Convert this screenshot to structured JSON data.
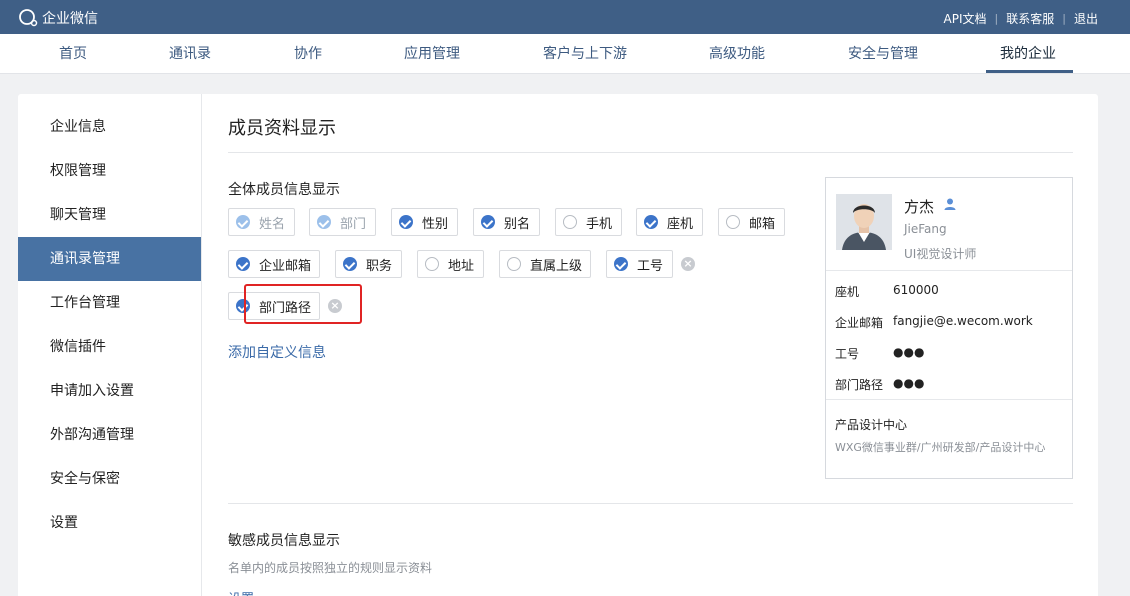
{
  "topbar": {
    "brand": "企业微信",
    "links": [
      {
        "label": "API文档"
      },
      {
        "label": "联系客服"
      },
      {
        "label": "退出"
      }
    ]
  },
  "nav": {
    "items": [
      {
        "label": "首页"
      },
      {
        "label": "通讯录"
      },
      {
        "label": "协作"
      },
      {
        "label": "应用管理"
      },
      {
        "label": "客户与上下游"
      },
      {
        "label": "高级功能"
      },
      {
        "label": "安全与管理"
      },
      {
        "label": "我的企业"
      }
    ],
    "active": "我的企业"
  },
  "sidebar": {
    "items": [
      {
        "label": "企业信息"
      },
      {
        "label": "权限管理"
      },
      {
        "label": "聊天管理"
      },
      {
        "label": "通讯录管理"
      },
      {
        "label": "工作台管理"
      },
      {
        "label": "微信插件"
      },
      {
        "label": "申请加入设置"
      },
      {
        "label": "外部沟通管理"
      },
      {
        "label": "安全与保密"
      },
      {
        "label": "设置"
      }
    ],
    "active": "通讯录管理"
  },
  "main": {
    "title": "成员资料显示",
    "all_section_label": "全体成员信息显示",
    "fields": [
      {
        "label": "姓名",
        "checked": true,
        "disabled": true
      },
      {
        "label": "部门",
        "checked": true,
        "disabled": true
      },
      {
        "label": "性别",
        "checked": true
      },
      {
        "label": "别名",
        "checked": true
      },
      {
        "label": "手机",
        "checked": false
      },
      {
        "label": "座机",
        "checked": true
      },
      {
        "label": "邮箱",
        "checked": false
      },
      {
        "label": "企业邮箱",
        "checked": true
      },
      {
        "label": "职务",
        "checked": true
      },
      {
        "label": "地址",
        "checked": false
      },
      {
        "label": "直属上级",
        "checked": false
      },
      {
        "label": "工号",
        "checked": true,
        "removable": true
      },
      {
        "label": "部门路径",
        "checked": true,
        "removable": true,
        "highlighted": true
      }
    ],
    "remove_glyph": "×",
    "add_custom_label": "添加自定义信息",
    "sensitive_section_label": "敏感成员信息显示",
    "sensitive_desc": "名单内的成员按照独立的规则显示资料",
    "sensitive_link": "设置"
  },
  "preview": {
    "name": "方杰",
    "alias": "JieFang",
    "job_title": "UI视觉设计师",
    "rows": [
      {
        "key": "座机",
        "value": "610000"
      },
      {
        "key": "企业邮箱",
        "value": "fangjie@e.wecom.work"
      },
      {
        "key": "工号",
        "value": "●●●"
      },
      {
        "key": "部门路径",
        "value": "●●●"
      }
    ],
    "department": "产品设计中心",
    "department_path": "WXG微信事业群/广州研发部/产品设计中心"
  },
  "colors": {
    "topbar": "#3f5f86",
    "accent": "#3c74c9",
    "sidebar_active": "#4872a3",
    "highlight": "#e02424",
    "link": "#3a6aa8"
  },
  "icons": {
    "brand": "chat-bubble-icon",
    "check": "check-circle-icon",
    "remove": "remove-icon",
    "user": "user-icon"
  }
}
